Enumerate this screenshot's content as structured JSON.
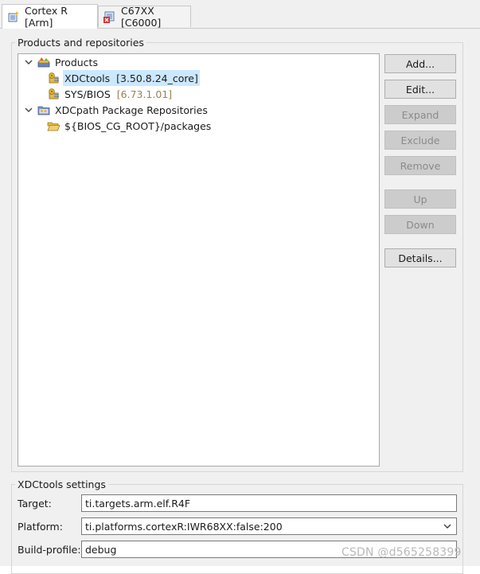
{
  "tabs": [
    {
      "label": "Cortex R [Arm]",
      "active": true,
      "icon": "target-core-icon"
    },
    {
      "label": "C67XX [C6000]",
      "active": false,
      "icon": "target-core-error-icon"
    }
  ],
  "products_group": {
    "title": "Products and repositories",
    "tree": {
      "products": {
        "label": "Products",
        "icon": "products-folder-icon"
      },
      "xdctools": {
        "label": "XDCtools",
        "version": "[3.50.8.24_core]",
        "icon": "package-product-icon"
      },
      "sysbios": {
        "label": "SYS/BIOS",
        "version": "[6.73.1.01]",
        "icon": "package-product-icon"
      },
      "repos": {
        "label": "XDCpath Package Repositories",
        "icon": "repository-folder-icon"
      },
      "repo_path": {
        "label": "${BIOS_CG_ROOT}/packages",
        "icon": "open-folder-icon"
      }
    },
    "buttons": {
      "add": "Add...",
      "edit": "Edit...",
      "expand": "Expand",
      "exclude": "Exclude",
      "remove": "Remove",
      "up": "Up",
      "down": "Down",
      "details": "Details..."
    }
  },
  "xdc_settings": {
    "title": "XDCtools settings",
    "target_label": "Target:",
    "target_value": "ti.targets.arm.elf.R4F",
    "platform_label": "Platform:",
    "platform_value": "ti.platforms.cortexR:IWR68XX:false:200",
    "build_profile_label": "Build-profile:",
    "build_profile_value": "debug"
  },
  "watermark": "CSDN @d565258399",
  "colors": {
    "selection": "#cce8ff",
    "version_text": "#9a8252",
    "panel_bg": "#f0f0f0",
    "button_bg": "#e1e1e1"
  }
}
